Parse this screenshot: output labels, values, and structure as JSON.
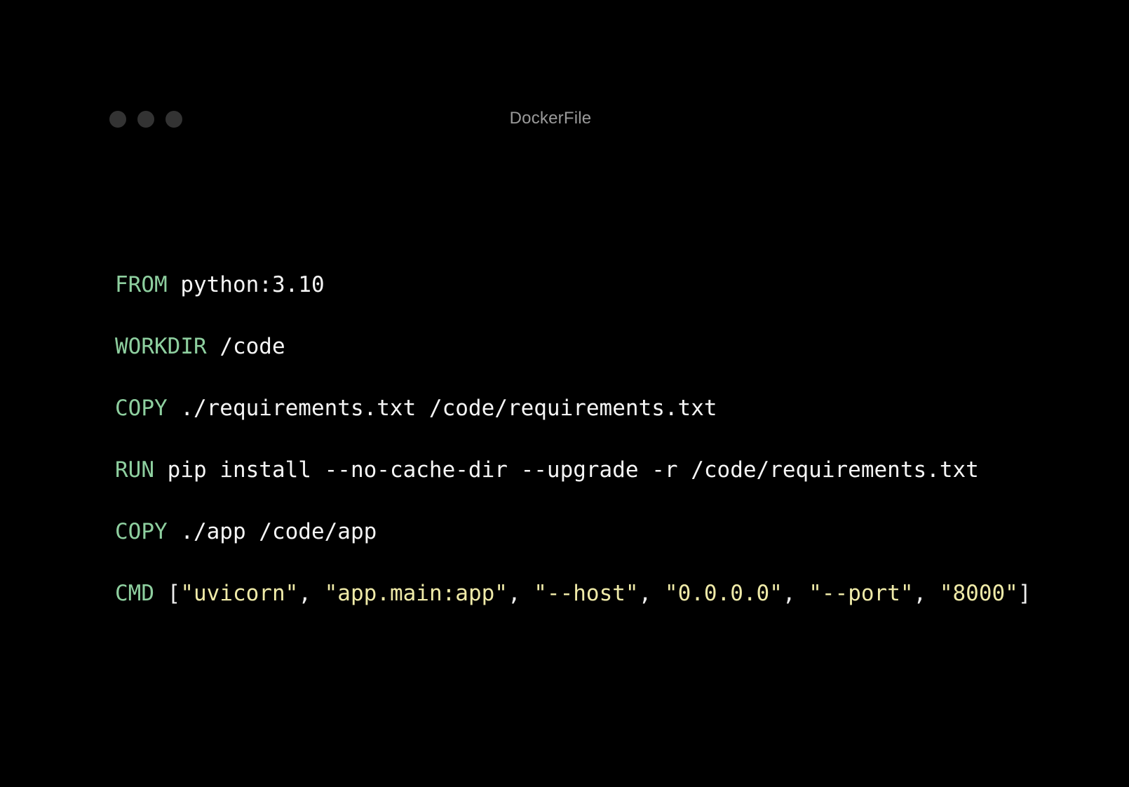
{
  "window": {
    "title": "DockerFile",
    "traffic_lights": [
      {
        "name": "close-dot",
        "color": "#333333"
      },
      {
        "name": "minimize-dot",
        "color": "#333333"
      },
      {
        "name": "maximize-dot",
        "color": "#333333"
      }
    ]
  },
  "theme": {
    "background": "#000000",
    "keyword": "#8ecf9f",
    "argument": "#f5f5f5",
    "string": "#efeaa8",
    "punctuation": "#eeeeee",
    "title_text": "#9a9a9a"
  },
  "file": {
    "name": "DockerFile",
    "language": "dockerfile",
    "lines": [
      {
        "index": 1,
        "text": "FROM python:3.10",
        "keyword": "FROM",
        "args": " python:3.10",
        "tokens": [
          {
            "type": "keyword",
            "text": "FROM"
          },
          {
            "type": "arg",
            "text": " python:3.10"
          }
        ]
      },
      {
        "index": 2,
        "text": "WORKDIR /code",
        "keyword": "WORKDIR",
        "args": " /code",
        "tokens": [
          {
            "type": "keyword",
            "text": "WORKDIR"
          },
          {
            "type": "arg",
            "text": " /code"
          }
        ]
      },
      {
        "index": 3,
        "text": "COPY ./requirements.txt /code/requirements.txt",
        "keyword": "COPY",
        "args": " ./requirements.txt /code/requirements.txt",
        "tokens": [
          {
            "type": "keyword",
            "text": "COPY"
          },
          {
            "type": "arg",
            "text": " ./requirements.txt /code/requirements.txt"
          }
        ]
      },
      {
        "index": 4,
        "text": "RUN pip install --no-cache-dir --upgrade -r /code/requirements.txt",
        "keyword": "RUN",
        "args": " pip install --no-cache-dir --upgrade -r /code/requirements.txt",
        "tokens": [
          {
            "type": "keyword",
            "text": "RUN"
          },
          {
            "type": "arg",
            "text": " pip install --no-cache-dir --upgrade -r /code/requirements.txt"
          }
        ]
      },
      {
        "index": 5,
        "text": "COPY ./app /code/app",
        "keyword": "COPY",
        "args": " ./app /code/app",
        "tokens": [
          {
            "type": "keyword",
            "text": "COPY"
          },
          {
            "type": "arg",
            "text": " ./app /code/app"
          }
        ]
      },
      {
        "index": 6,
        "text": "CMD [\"uvicorn\", \"app.main:app\", \"--host\", \"0.0.0.0\", \"--port\", \"8000\"]",
        "keyword": "CMD",
        "args": " [\"uvicorn\", \"app.main:app\", \"--host\", \"0.0.0.0\", \"--port\", \"8000\"]",
        "tokens": [
          {
            "type": "keyword",
            "text": "CMD"
          },
          {
            "type": "punct",
            "text": " ["
          },
          {
            "type": "string",
            "text": "\"uvicorn\""
          },
          {
            "type": "punct",
            "text": ", "
          },
          {
            "type": "string",
            "text": "\"app.main:app\""
          },
          {
            "type": "punct",
            "text": ", "
          },
          {
            "type": "string",
            "text": "\"--host\""
          },
          {
            "type": "punct",
            "text": ", "
          },
          {
            "type": "string",
            "text": "\"0.0.0.0\""
          },
          {
            "type": "punct",
            "text": ", "
          },
          {
            "type": "string",
            "text": "\"--port\""
          },
          {
            "type": "punct",
            "text": ", "
          },
          {
            "type": "string",
            "text": "\"8000\""
          },
          {
            "type": "punct",
            "text": "]"
          }
        ]
      }
    ]
  }
}
